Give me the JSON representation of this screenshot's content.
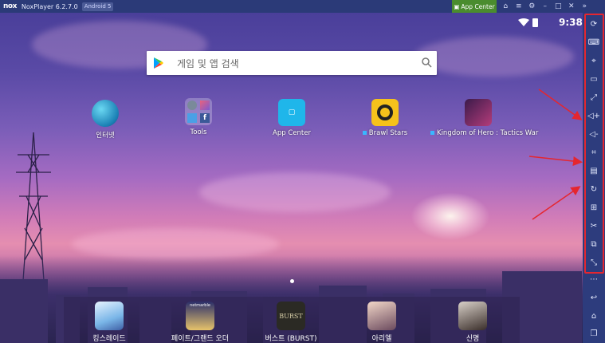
{
  "titlebar": {
    "logo": "nox",
    "title": "NoxPlayer 6.2.7.0",
    "android_badge": "Android 5",
    "app_center_label": "App Center"
  },
  "statusbar": {
    "time": "9:38"
  },
  "search": {
    "placeholder": "게임 및 앱 검색"
  },
  "apps": [
    {
      "label": "인터넷",
      "icon": "globe-icon",
      "new": false
    },
    {
      "label": "Tools",
      "icon": "tools-folder-icon",
      "new": false
    },
    {
      "label": "App Center",
      "icon": "nox-app-center-icon",
      "new": false
    },
    {
      "label": "Brawl Stars",
      "icon": "brawl-stars-icon",
      "new": true
    },
    {
      "label": "Kingdom of Hero : Tactics War",
      "icon": "kingdom-of-hero-icon",
      "new": true
    }
  ],
  "dock": [
    {
      "label": "킹스레이드",
      "icon": "kings-raid-icon"
    },
    {
      "label": "페이트/그랜드 오더",
      "icon": "fate-grand-order-icon"
    },
    {
      "label": "버스트 (BURST)",
      "icon": "burst-icon"
    },
    {
      "label": "아리엘",
      "icon": "ariel-icon"
    },
    {
      "label": "신명",
      "icon": "shinmyeong-icon"
    }
  ],
  "dock_icon_texts": {
    "netmarble": "netmarble",
    "burst": "BURST"
  },
  "sidebar_tools": [
    "screen-rotate-icon",
    "keyboard-icon",
    "location-icon",
    "multi-display-icon",
    "fullscreen-icon",
    "volume-up-icon",
    "volume-down-icon",
    "macro-icon",
    "toolbox-icon",
    "refresh-icon",
    "apk-install-icon",
    "scissors-icon",
    "multi-instance-icon",
    "expand-icon",
    "more-icon",
    "back-icon",
    "home-icon",
    "recent-apps-icon"
  ],
  "colors": {
    "titlebar": "#2b3a78",
    "app_center_button": "#4a8c2e",
    "highlight": "#e5262f"
  }
}
